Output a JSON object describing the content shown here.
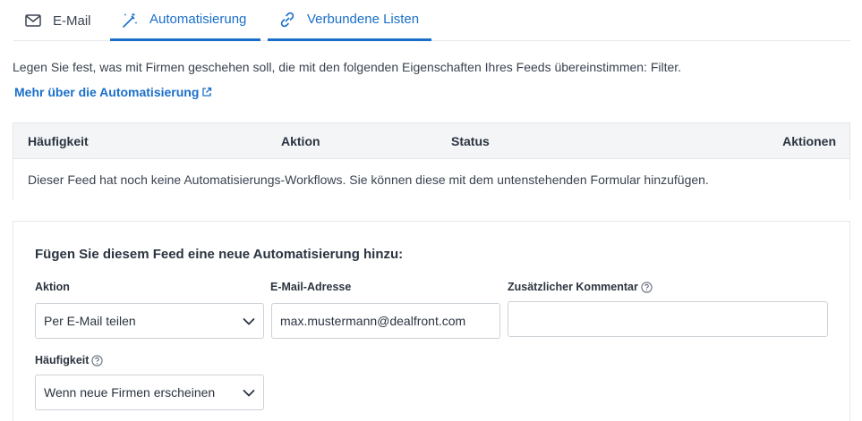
{
  "tabs": [
    {
      "label": "E-Mail",
      "icon": "envelope-icon"
    },
    {
      "label": "Automatisierung",
      "icon": "magic-wand-icon"
    },
    {
      "label": "Verbundene Listen",
      "icon": "link-icon"
    }
  ],
  "intro_text": "Legen Sie fest, was mit Firmen geschehen soll, die mit den folgenden Eigenschaften Ihres Feeds übereinstimmen: Filter.",
  "more_link": "Mehr über die Automatisierung",
  "table": {
    "columns": [
      "Häufigkeit",
      "Aktion",
      "Status",
      "Aktionen"
    ],
    "empty_message": "Dieser Feed hat noch keine Automatisierungs-Workflows. Sie können diese mit dem untenstehenden Formular hinzufügen."
  },
  "form": {
    "title": "Fügen Sie diesem Feed eine neue Automatisierung hinzu:",
    "action_label": "Aktion",
    "action_value": "Per E-Mail teilen",
    "email_label": "E-Mail-Adresse",
    "email_value": "max.mustermann@dealfront.com",
    "comment_label": "Zusätzlicher Kommentar",
    "comment_value": "",
    "frequency_label": "Häufigkeit",
    "frequency_value": "Wenn neue Firmen erscheinen"
  },
  "colors": {
    "accent": "#1a6fc9",
    "text": "#2b3440",
    "header_bg": "#f3f5f7",
    "border": "#cdd2d8"
  }
}
